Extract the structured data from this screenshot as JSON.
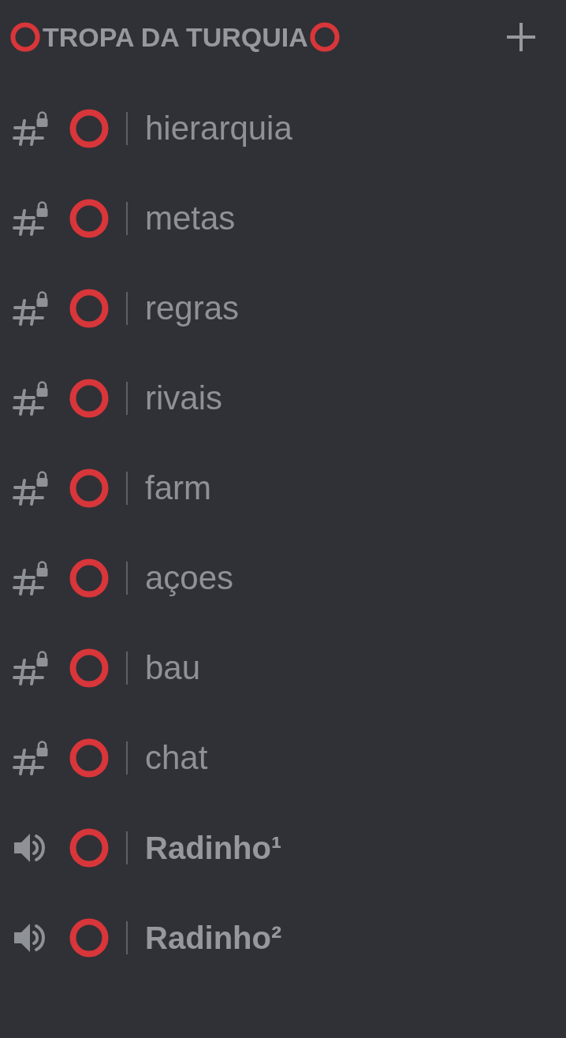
{
  "category": {
    "title": "TROPA DA TURQUIA"
  },
  "channels": [
    {
      "kind": "text",
      "name": "hierarquia",
      "locked": true
    },
    {
      "kind": "text",
      "name": "metas",
      "locked": true
    },
    {
      "kind": "text",
      "name": "regras",
      "locked": true
    },
    {
      "kind": "text",
      "name": "rivais",
      "locked": true
    },
    {
      "kind": "text",
      "name": "farm",
      "locked": true
    },
    {
      "kind": "text",
      "name": "açoes",
      "locked": true
    },
    {
      "kind": "text",
      "name": "bau",
      "locked": true
    },
    {
      "kind": "text",
      "name": "chat",
      "locked": true
    },
    {
      "kind": "voice",
      "name": "Radinho¹",
      "locked": false
    },
    {
      "kind": "voice",
      "name": "Radinho²",
      "locked": false
    }
  ]
}
